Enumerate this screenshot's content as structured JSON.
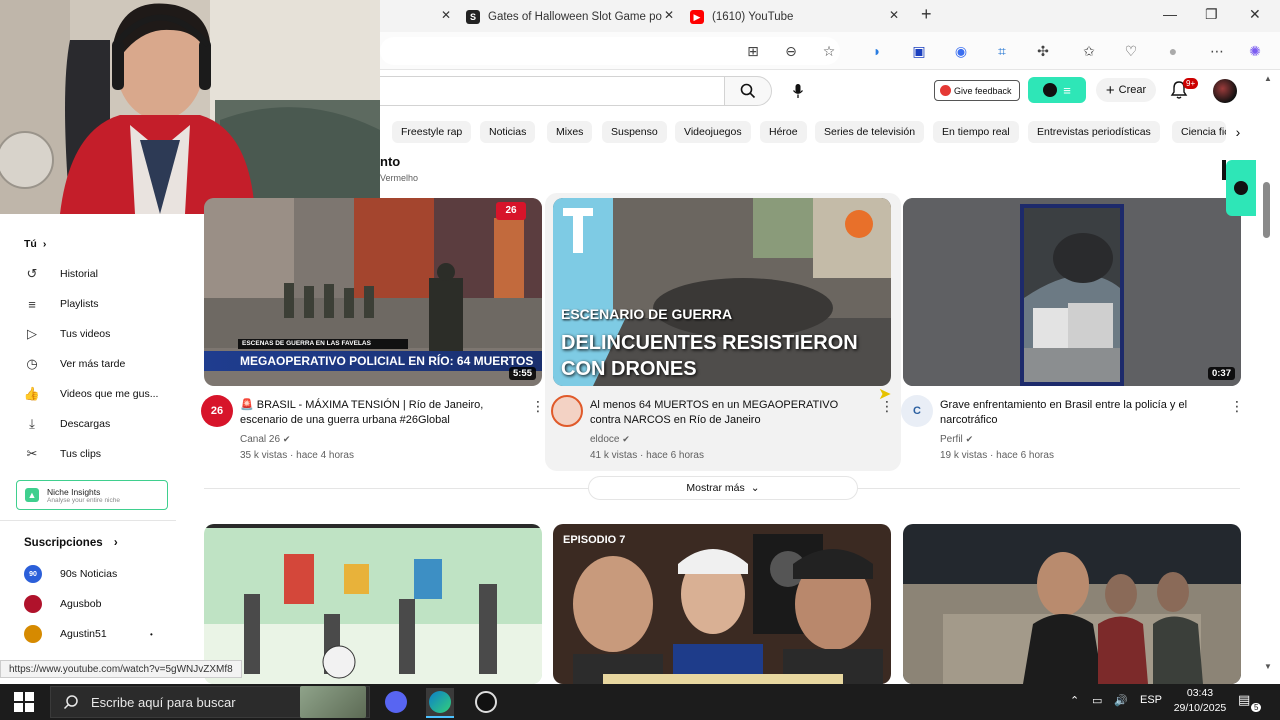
{
  "browser": {
    "tabs": [
      {
        "title": "Gates of Halloween Slot Game po",
        "fav": "S",
        "color": "#222222"
      },
      {
        "title": "(1610) YouTube",
        "fav": "▶",
        "color": "#ff0000"
      }
    ],
    "new_tab": "+",
    "status_url": "https://www.youtube.com/watch?v=5gWNJvZXMf8"
  },
  "youtube": {
    "feedback_label": "Give feedback",
    "create_label": "Crear",
    "notif_badge": "9+",
    "chips": [
      "Freestyle rap",
      "Noticias",
      "Mixes",
      "Suspenso",
      "Videojuegos",
      "Héroe",
      "Series de televisión",
      "En tiempo real",
      "Entrevistas periodísticas",
      "Ciencia fic"
    ],
    "section": {
      "title": "nto",
      "sub": "Vermelho"
    },
    "show_more": "Mostrar más"
  },
  "sidebar": {
    "you_label": "Tú",
    "items": [
      {
        "label": "Historial",
        "icon": "history-icon",
        "glyph": "↺"
      },
      {
        "label": "Playlists",
        "icon": "playlists-icon",
        "glyph": "≡"
      },
      {
        "label": "Tus videos",
        "icon": "your-videos-icon",
        "glyph": "▷"
      },
      {
        "label": "Ver más tarde",
        "icon": "watch-later-icon",
        "glyph": "◷"
      },
      {
        "label": "Videos que me gus...",
        "icon": "like-icon",
        "glyph": "👍"
      },
      {
        "label": "Descargas",
        "icon": "download-icon",
        "glyph": "⤓"
      },
      {
        "label": "Tus clips",
        "icon": "scissors-icon",
        "glyph": "✂"
      }
    ],
    "niche": {
      "title": "Niche Insights",
      "sub": "Analyse your entire niche"
    },
    "subs_label": "Suscripciones",
    "subscriptions": [
      {
        "name": "90s Noticias",
        "color": "#2b5fd9",
        "text": "90"
      },
      {
        "name": "Agusbob",
        "color": "#b0122b",
        "text": ""
      },
      {
        "name": "Agustin51",
        "color": "#d68a00",
        "text": ""
      }
    ]
  },
  "videos": [
    {
      "title_line1": "🚨 BRASIL - MÁXIMA TENSIÓN | Río de Janeiro,",
      "title_line2": "escenario de una guerra urbana #26Global",
      "channel": "Canal 26",
      "meta": "35 k vistas · hace 4 horas",
      "duration": "5:55",
      "overlay_top": "ESCENAS DE GUERRA EN LAS FAVELAS",
      "overlay_main": "MEGAOPERATIVO POLICIAL EN RÍO: 64 MUERTOS",
      "avatar_text": "26",
      "avatar_color": "#d7142a"
    },
    {
      "title_line1": "Al menos 64 MUERTOS en un MEGAOPERATIVO",
      "title_line2": "contra NARCOS en Río de Janeiro",
      "channel": "eldoce",
      "meta": "41 k vistas · hace 6 horas",
      "overlay_top": "ESCENARIO DE GUERRA",
      "overlay_main1": "DELINCUENTES RESISTIERON",
      "overlay_main2": "CON DRONES",
      "avatar_text": "",
      "avatar_color": "#e05a2a"
    },
    {
      "title_line1": "Grave enfrentamiento en Brasil entre la policía y el",
      "title_line2": "narcotráfico",
      "channel": "Perfil",
      "meta": "19 k vistas · hace 6 horas",
      "duration": "0:37",
      "avatar_text": "",
      "avatar_color": "#2a5fa0"
    }
  ],
  "row2": {
    "episode_label": "EPISODIO 7"
  },
  "taskbar": {
    "search_placeholder": "Escribe aquí para buscar",
    "lang": "ESP",
    "time": "03:43",
    "date": "29/10/2025",
    "notif_count": "5"
  }
}
